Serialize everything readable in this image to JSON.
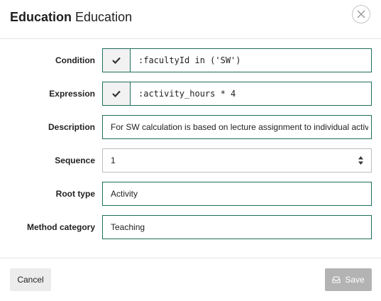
{
  "dialog": {
    "title_bold": "Education",
    "title_rest": "Education"
  },
  "fields": {
    "condition": {
      "label": "Condition",
      "value": ":facultyId in ('SW')"
    },
    "expression": {
      "label": "Expression",
      "value": ":activity_hours * 4"
    },
    "description": {
      "label": "Description",
      "value": "For SW calculation is based on lecture assignment to individual activity"
    },
    "sequence": {
      "label": "Sequence",
      "value": "1"
    },
    "root_type": {
      "label": "Root type",
      "value": "Activity"
    },
    "method_category": {
      "label": "Method category",
      "value": "Teaching"
    }
  },
  "footer": {
    "cancel_label": "Cancel",
    "save_label": "Save"
  },
  "colors": {
    "field_border": "#1e6e5c",
    "save_disabled_bg": "#b3b3b3",
    "cancel_bg": "#ececec"
  },
  "icons": [
    "close-icon",
    "check-icon",
    "spinner-arrows-icon",
    "save-icon"
  ]
}
